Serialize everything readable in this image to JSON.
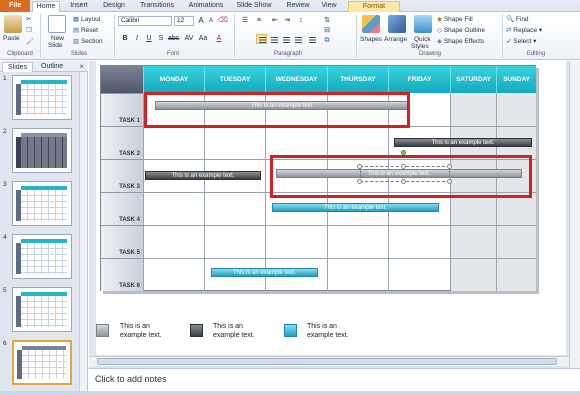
{
  "ribbon_tabs": [
    {
      "label": "File"
    },
    {
      "label": "Home"
    },
    {
      "label": "Insert"
    },
    {
      "label": "Design"
    },
    {
      "label": "Transitions"
    },
    {
      "label": "Animations"
    },
    {
      "label": "Slide Show"
    },
    {
      "label": "Review"
    },
    {
      "label": "View"
    },
    {
      "label": "Format"
    }
  ],
  "ribbon": {
    "clipboard": {
      "paste": "Paste",
      "group": "Clipboard"
    },
    "slides": {
      "new_slide_1": "New",
      "new_slide_2": "Slide",
      "layout": "Layout",
      "reset": "Reset",
      "section": "Section",
      "group": "Slides"
    },
    "font": {
      "name": "Calibri",
      "size": "12",
      "group": "Font"
    },
    "paragraph": {
      "group": "Paragraph"
    },
    "drawing": {
      "shapes": "Shapes",
      "arrange": "Arrange",
      "quick_styles_1": "Quick",
      "quick_styles_2": "Styles",
      "shape_fill": "Shape Fill",
      "shape_outline": "Shape Outline",
      "shape_effects": "Shape Effects",
      "group": "Drawing"
    },
    "editing": {
      "find": "Find",
      "replace": "Replace",
      "select": "Select",
      "group": "Editing"
    }
  },
  "panel": {
    "tabs": [
      "Slides",
      "Outline"
    ],
    "close": "×",
    "slide_numbers": [
      "1",
      "2",
      "3",
      "4",
      "5",
      "6"
    ],
    "current": "6"
  },
  "calendar": {
    "days": [
      "MONDAY",
      "TUESDAY",
      "WEDNESDAY",
      "THURSDAY",
      "FRIDAY",
      "SATURDAY",
      "SUNDAY"
    ],
    "tasks": [
      "TASK 1",
      "TASK 2",
      "TASK 3",
      "TASK 4",
      "TASK 5",
      "TASK 6"
    ],
    "events": [
      {
        "text": "This is an example text.",
        "style": "gray"
      },
      {
        "text": "This is an example text.",
        "style": "dark"
      },
      {
        "text": "This is an example text.",
        "style": "dark"
      },
      {
        "text": "This is an example text.",
        "style": "gray"
      },
      {
        "text": "This is an example text.",
        "style": "cyan"
      },
      {
        "text": "This is an example text.",
        "style": "cyan"
      }
    ]
  },
  "legend": [
    {
      "line1": "This is an",
      "line2": "example text."
    },
    {
      "line1": "This is an",
      "line2": "example text."
    },
    {
      "line1": "This is an",
      "line2": "example text."
    }
  ],
  "notes": {
    "placeholder": "Click to add notes"
  },
  "colors": {
    "accent_cyan": "#12a9bd",
    "file_tab": "#d86c20",
    "highlight_red": "#d42020"
  }
}
